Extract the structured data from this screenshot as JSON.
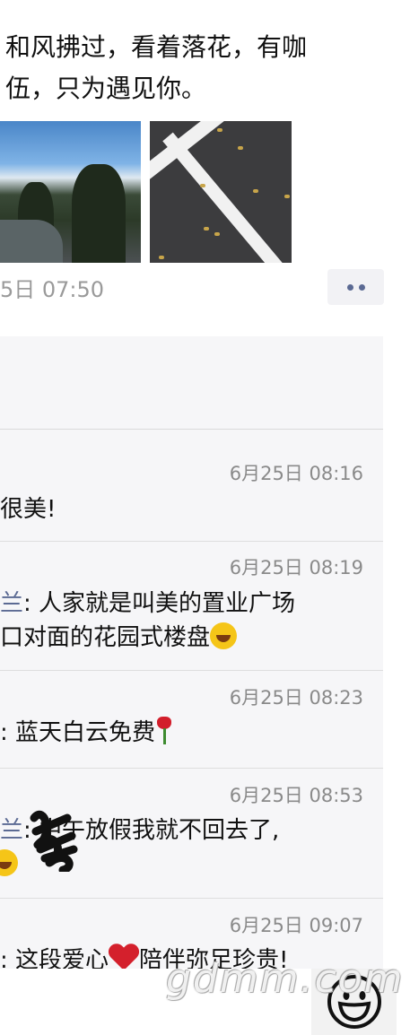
{
  "post": {
    "text_line1": "和风拂过，看着落花，有咖",
    "text_line2": "伍，只为遇见你。",
    "timestamp": "5日 07:50"
  },
  "comments": [
    {
      "time": "6月25日 08:16",
      "lines": [
        [
          "",
          "很美!"
        ]
      ]
    },
    {
      "time": "6月25日 08:19",
      "lines": [
        [
          "兰",
          ": 人家就是叫美的置业广场"
        ],
        [
          "",
          "口对面的花园式楼盘"
        ]
      ]
    },
    {
      "time": "6月25日 08:23",
      "lines": [
        [
          "",
          ": 蓝天白云免费"
        ]
      ]
    },
    {
      "time": "6月25日 08:53",
      "lines": [
        [
          "兰",
          ":    中午放假我就不回去了,"
        ]
      ]
    },
    {
      "time": "6月25日 09:07",
      "lines": [
        [
          "",
          ": 这段爱心"
        ],
        [
          "",
          "陪伴弥足珍贵!"
        ]
      ]
    }
  ],
  "icons": {
    "more": "more-dots-icon",
    "emoji": "smiley-face-icon"
  },
  "watermark": "gdmm.com",
  "colors": {
    "name_link": "#5b6a93",
    "timestamp": "#9a9a9a",
    "comment_bg": "#f6f6f8"
  }
}
